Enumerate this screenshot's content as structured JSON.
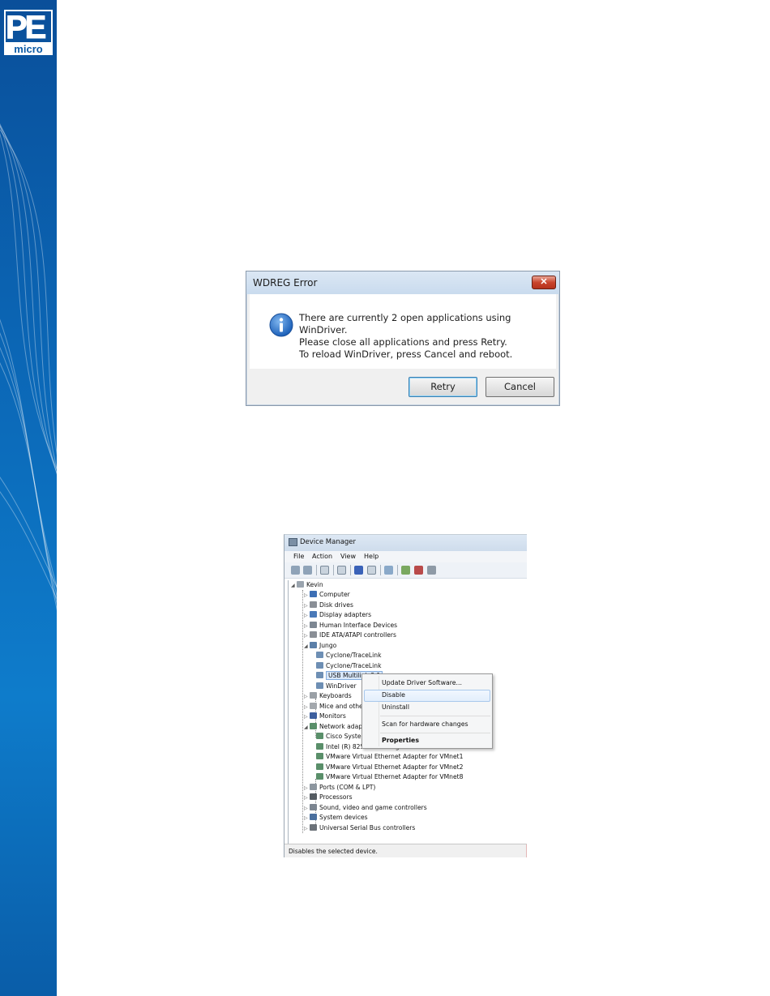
{
  "logo": {
    "top": "PE",
    "bottom": "micro"
  },
  "dialog": {
    "title": "WDREG Error",
    "close_glyph": "✕",
    "icon": "info-icon",
    "message": [
      "There are currently 2 open applications using WinDriver.",
      "Please close all applications and press Retry.",
      "To reload WinDriver, press Cancel and reboot."
    ],
    "retry_label": "Retry",
    "cancel_label": "Cancel"
  },
  "device_manager": {
    "title": "Device Manager",
    "menu": [
      "File",
      "Action",
      "View",
      "Help"
    ],
    "tree": {
      "root": "Kevin",
      "nodes": [
        "Computer",
        "Disk drives",
        "Display adapters",
        "Human Interface Devices",
        "IDE ATA/ATAPI controllers",
        "Jungo",
        "Cyclone/TraceLink",
        "Cyclone/TraceLink",
        "USB Multilink 2.1",
        "WinDriver",
        "Keyboards",
        "Mice and other pointing devices",
        "Monitors",
        "Network adapters",
        "Cisco Systems VPN Adapter",
        "Intel (R) 82567LM-3 Gigabit Network Connection",
        "VMware Virtual Ethernet Adapter for VMnet1",
        "VMware Virtual Ethernet Adapter for VMnet2",
        "VMware Virtual Ethernet Adapter for VMnet8",
        "Ports (COM & LPT)",
        "Processors",
        "Sound, video and game controllers",
        "System devices",
        "Universal Serial Bus controllers"
      ]
    },
    "context_menu": {
      "items": [
        "Update Driver Software...",
        "Disable",
        "Uninstall",
        "Scan for hardware changes",
        "Properties"
      ],
      "highlighted": "Disable"
    },
    "status": "Disables the selected device."
  }
}
